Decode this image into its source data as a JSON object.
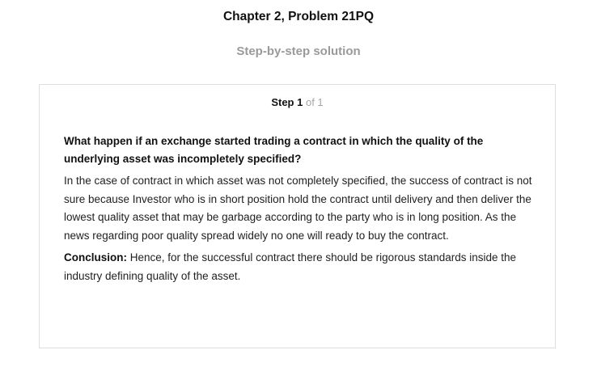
{
  "header": {
    "title": "Chapter 2, Problem 21PQ",
    "subtitle": "Step-by-step solution"
  },
  "step": {
    "label": "Step 1",
    "count": "of 1"
  },
  "solution": {
    "question": "What happen if an exchange started trading a contract in which the quality of the underlying asset was incompletely specified?",
    "body": "In the case of contract in which asset was not completely specified, the success of contract is not sure because Investor who is in short position hold the contract until delivery and then deliver the lowest quality asset that may be garbage according to the party who is in long position. As the news regarding poor quality spread widely no one will ready to buy the contract.",
    "conclusion_label": "Conclusion:",
    "conclusion_text": "Hence, for the successful contract there should be rigorous standards inside the industry defining quality of the asset."
  },
  "colors": {
    "subtitle": "#9a9a9a",
    "step_count": "#a5a5a5",
    "card_border": "#dedede"
  }
}
